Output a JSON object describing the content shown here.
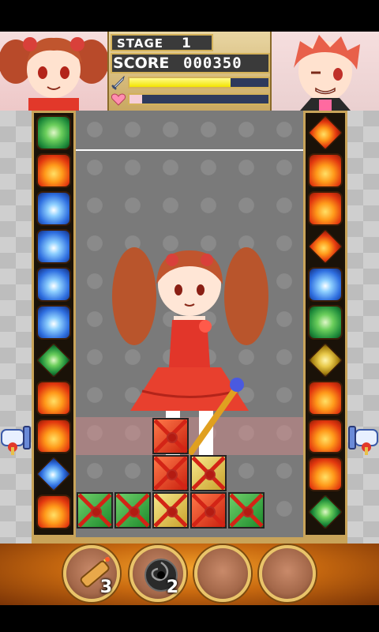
{
  "hud": {
    "stage_label": "STAGE",
    "stage_number": "1",
    "score_label": "SCORE",
    "score_value": "000350",
    "attack_meter_fraction": 0.73,
    "health_meter_fraction": 0.09
  },
  "colors": {
    "header_gold": "#d9b873",
    "meter_yellow": "#f2e400",
    "meter_track": "#2e3a5c",
    "cross_red": "#d32416"
  },
  "left_column_gems": [
    "wind",
    "fire",
    "water",
    "water",
    "water",
    "water",
    "wind-diamond",
    "fire",
    "fire",
    "water-diamond",
    "fire"
  ],
  "right_column_gems": [
    "fire-diamond",
    "fire",
    "fire",
    "fire-diamond",
    "water",
    "wind",
    "earth-diamond",
    "fire",
    "fire",
    "fire",
    "wind-diamond"
  ],
  "playfield_blocks": [
    {
      "row": 0,
      "col": 2,
      "color": "red"
    },
    {
      "row": 1,
      "col": 2,
      "color": "red"
    },
    {
      "row": 1,
      "col": 3,
      "color": "yellow"
    },
    {
      "row": 2,
      "col": 0,
      "color": "green"
    },
    {
      "row": 2,
      "col": 1,
      "color": "green"
    },
    {
      "row": 2,
      "col": 2,
      "color": "yellow"
    },
    {
      "row": 2,
      "col": 3,
      "color": "red"
    },
    {
      "row": 2,
      "col": 4,
      "color": "green"
    }
  ],
  "items": [
    {
      "icon": "bomb-icon",
      "count": "3"
    },
    {
      "icon": "black-hole-icon",
      "count": "2"
    },
    {
      "icon": "empty-slot",
      "count": ""
    },
    {
      "icon": "empty-slot",
      "count": ""
    }
  ]
}
